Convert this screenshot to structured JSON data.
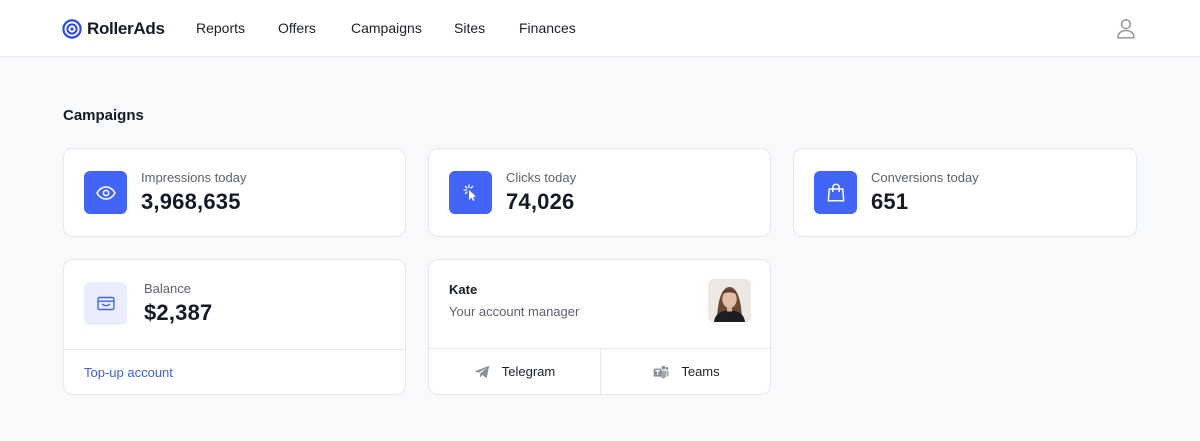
{
  "brand": {
    "name": "RollerAds"
  },
  "nav": {
    "items": [
      {
        "label": "Reports"
      },
      {
        "label": "Offers"
      },
      {
        "label": "Campaigns"
      },
      {
        "label": "Sites"
      },
      {
        "label": "Finances"
      }
    ]
  },
  "page": {
    "title": "Campaigns"
  },
  "stats": [
    {
      "label": "Impressions today",
      "value": "3,968,635",
      "icon": "eye-icon"
    },
    {
      "label": "Clicks today",
      "value": "74,026",
      "icon": "cursor-click-icon"
    },
    {
      "label": "Conversions today",
      "value": "651",
      "icon": "shopping-bag-icon"
    }
  ],
  "balance": {
    "label": "Balance",
    "value": "$2,387",
    "icon": "wallet-icon",
    "action_label": "Top-up account"
  },
  "manager": {
    "name": "Kate",
    "role": "Your account manager",
    "contacts": [
      {
        "label": "Telegram",
        "icon": "telegram-icon"
      },
      {
        "label": "Teams",
        "icon": "teams-icon"
      }
    ]
  },
  "colors": {
    "accent": "#4265f5",
    "link": "#3a5fd9",
    "background": "#f8f9fb",
    "card": "#ffffff",
    "border": "#e3e6ec"
  }
}
